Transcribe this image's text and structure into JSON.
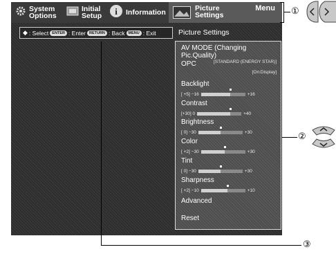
{
  "tabs": [
    {
      "label": "System\nOptions",
      "icon": "gear-icon"
    },
    {
      "label": "Initial\nSetup",
      "icon": "setup-icon"
    },
    {
      "label": "Information",
      "icon": "info-icon"
    },
    {
      "label": "Picture\nSettings",
      "icon": "picture-icon"
    }
  ],
  "menu_label": "Menu",
  "navbar": {
    "select": ": Select",
    "enter_btn": "ENTER",
    "enter": ": Enter",
    "return_btn": "RETURN",
    "back": ": Back",
    "menu_btn": "MENU",
    "exit": ": Exit"
  },
  "section_title": "Picture Settings",
  "items": {
    "av_mode": {
      "label": "AV MODE (Changing Pic.Quality)",
      "value": "[STANDARD (ENERGY STAR)]"
    },
    "opc": {
      "label": "OPC",
      "value": "[On:Display]"
    },
    "backlight": {
      "label": "Backlight",
      "current": "[ +5]",
      "min": "−16",
      "max": "+16",
      "level": 0.66
    },
    "contrast": {
      "label": "Contrast",
      "current": "[+30]",
      "min": "0",
      "max": "+40",
      "level": 0.75
    },
    "brightness": {
      "label": "Brightness",
      "current": "[  0]",
      "min": "−30",
      "max": "+30",
      "level": 0.5
    },
    "color": {
      "label": "Color",
      "current": "[ +2]",
      "min": "−30",
      "max": "+30",
      "level": 0.53
    },
    "tint": {
      "label": "Tint",
      "current": "[  0]",
      "min": "−30",
      "max": "+30",
      "level": 0.5
    },
    "sharpness": {
      "label": "Sharpness",
      "current": "[ +2]",
      "min": "−10",
      "max": "+10",
      "level": 0.6
    },
    "advanced": {
      "label": "Advanced"
    },
    "reset": {
      "label": "Reset"
    }
  },
  "callouts": {
    "one": "①",
    "two": "②",
    "three": "③"
  }
}
